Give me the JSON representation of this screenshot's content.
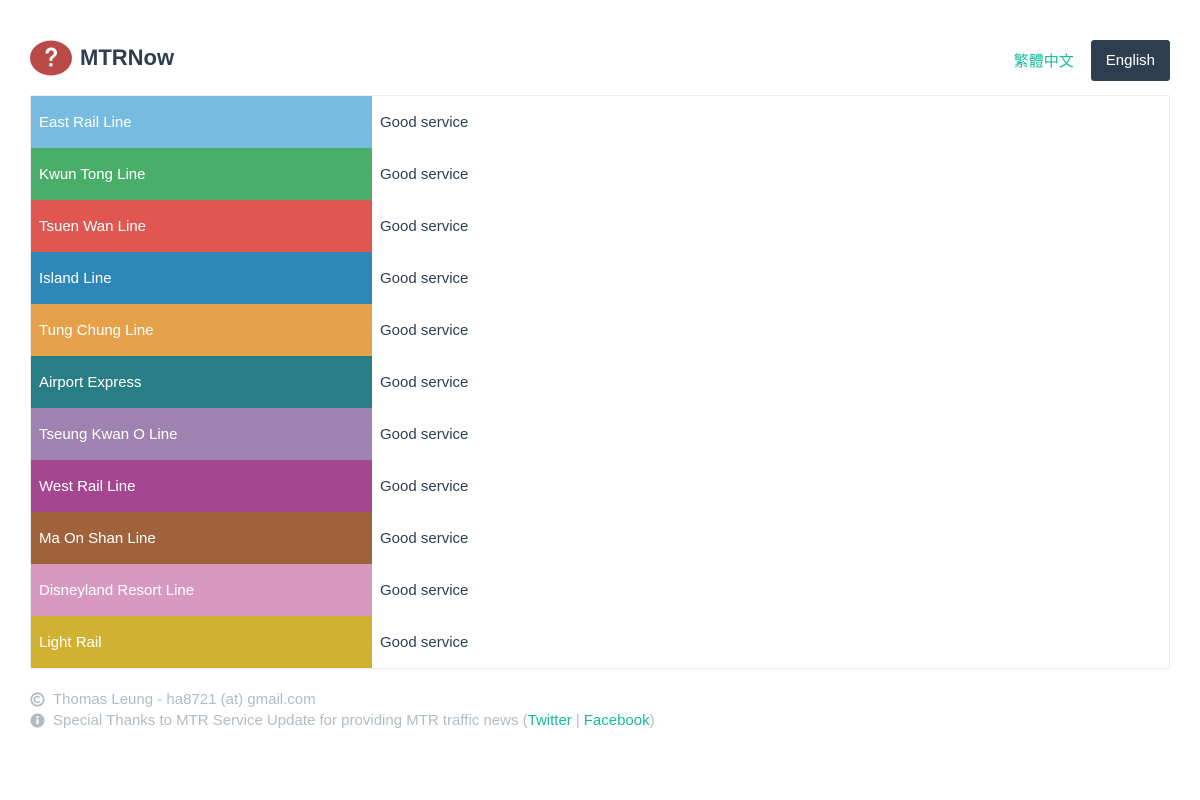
{
  "brand": {
    "name": "MTRNow",
    "logo_icon": "question-mark-circle-icon",
    "logo_color": "#b94a48"
  },
  "language": {
    "chinese_label": "繁體中文",
    "english_label": "English"
  },
  "lines": [
    {
      "name": "East Rail Line",
      "status": "Good service",
      "color": "#75bce0"
    },
    {
      "name": "Kwun Tong Line",
      "status": "Good service",
      "color": "#4aae6b"
    },
    {
      "name": "Tsuen Wan Line",
      "status": "Good service",
      "color": "#df5750"
    },
    {
      "name": "Island Line",
      "status": "Good service",
      "color": "#2f87b8"
    },
    {
      "name": "Tung Chung Line",
      "status": "Good service",
      "color": "#e6a24b"
    },
    {
      "name": "Airport Express",
      "status": "Good service",
      "color": "#287e85"
    },
    {
      "name": "Tseung Kwan O Line",
      "status": "Good service",
      "color": "#9f82b0"
    },
    {
      "name": "West Rail Line",
      "status": "Good service",
      "color": "#a44690"
    },
    {
      "name": "Ma On Shan Line",
      "status": "Good service",
      "color": "#a0623a"
    },
    {
      "name": "Disneyland Resort Line",
      "status": "Good service",
      "color": "#d899c0"
    },
    {
      "name": "Light Rail",
      "status": "Good service",
      "color": "#d1b131"
    }
  ],
  "footer": {
    "copyright_icon": "copyright-icon",
    "copyright_text": "Thomas Leung - ha8721 (at) gmail.com",
    "info_icon": "info-icon",
    "thanks_prefix": "Special Thanks to MTR Service Update for providing MTR traffic news (",
    "twitter_label": "Twitter",
    "separator": "|",
    "facebook_label": "Facebook",
    "thanks_suffix": ")"
  }
}
